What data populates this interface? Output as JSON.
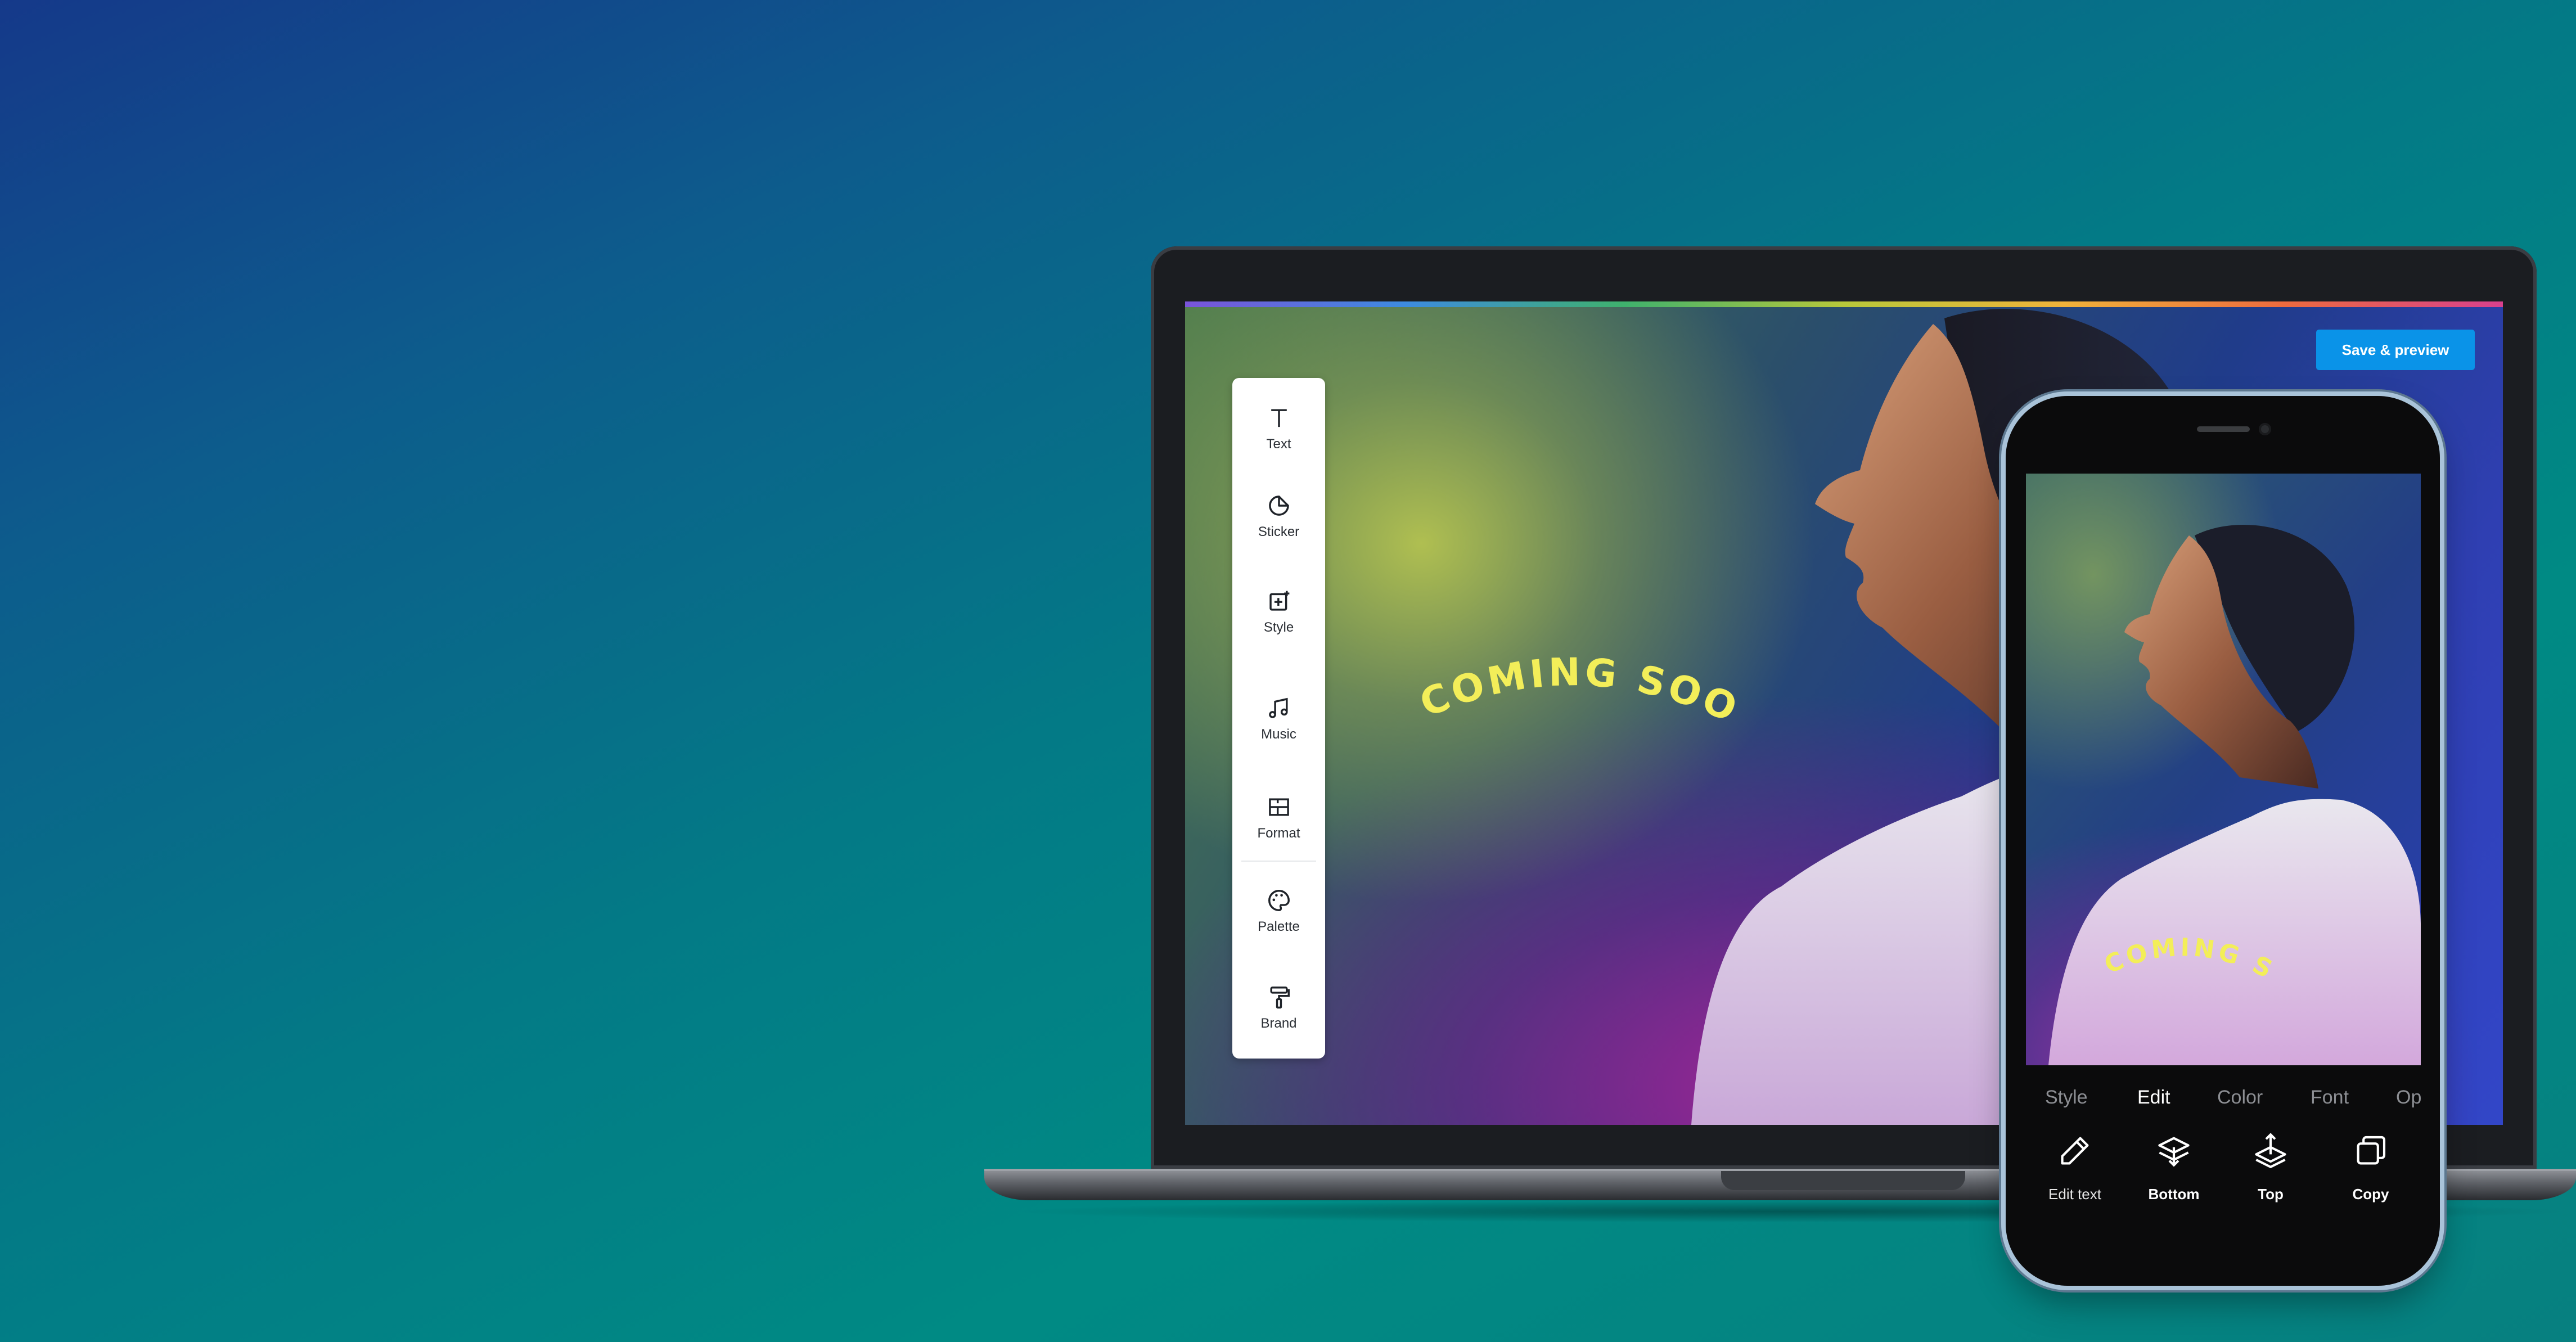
{
  "laptop": {
    "save_button_label": "Save & preview",
    "banner_text": "COMING SOON",
    "toolbar": [
      {
        "label": "Text",
        "icon": "text-icon"
      },
      {
        "label": "Sticker",
        "icon": "sticker-icon"
      },
      {
        "label": "Style",
        "icon": "style-icon"
      },
      {
        "label": "Music",
        "icon": "music-icon"
      },
      {
        "label": "Format",
        "icon": "format-icon"
      },
      {
        "label": "Palette",
        "icon": "palette-icon"
      },
      {
        "label": "Brand",
        "icon": "brand-icon"
      }
    ]
  },
  "phone": {
    "banner_text": "COMING SOON",
    "tabs": [
      {
        "label": "Style",
        "active": false
      },
      {
        "label": "Edit",
        "active": true
      },
      {
        "label": "Color",
        "active": false
      },
      {
        "label": "Font",
        "active": false
      },
      {
        "label": "Op",
        "active": false
      }
    ],
    "actions": [
      {
        "label": "Edit text",
        "icon": "pencil-icon"
      },
      {
        "label": "Bottom",
        "icon": "layer-bottom-icon"
      },
      {
        "label": "Top",
        "icon": "layer-top-icon"
      },
      {
        "label": "Copy",
        "icon": "copy-icon"
      }
    ]
  },
  "colors": {
    "accent_button": "#0a93e8",
    "banner_text": "#f3ee59",
    "toolbar_bg": "#ffffff",
    "phone_bg": "#0b0b0c"
  }
}
